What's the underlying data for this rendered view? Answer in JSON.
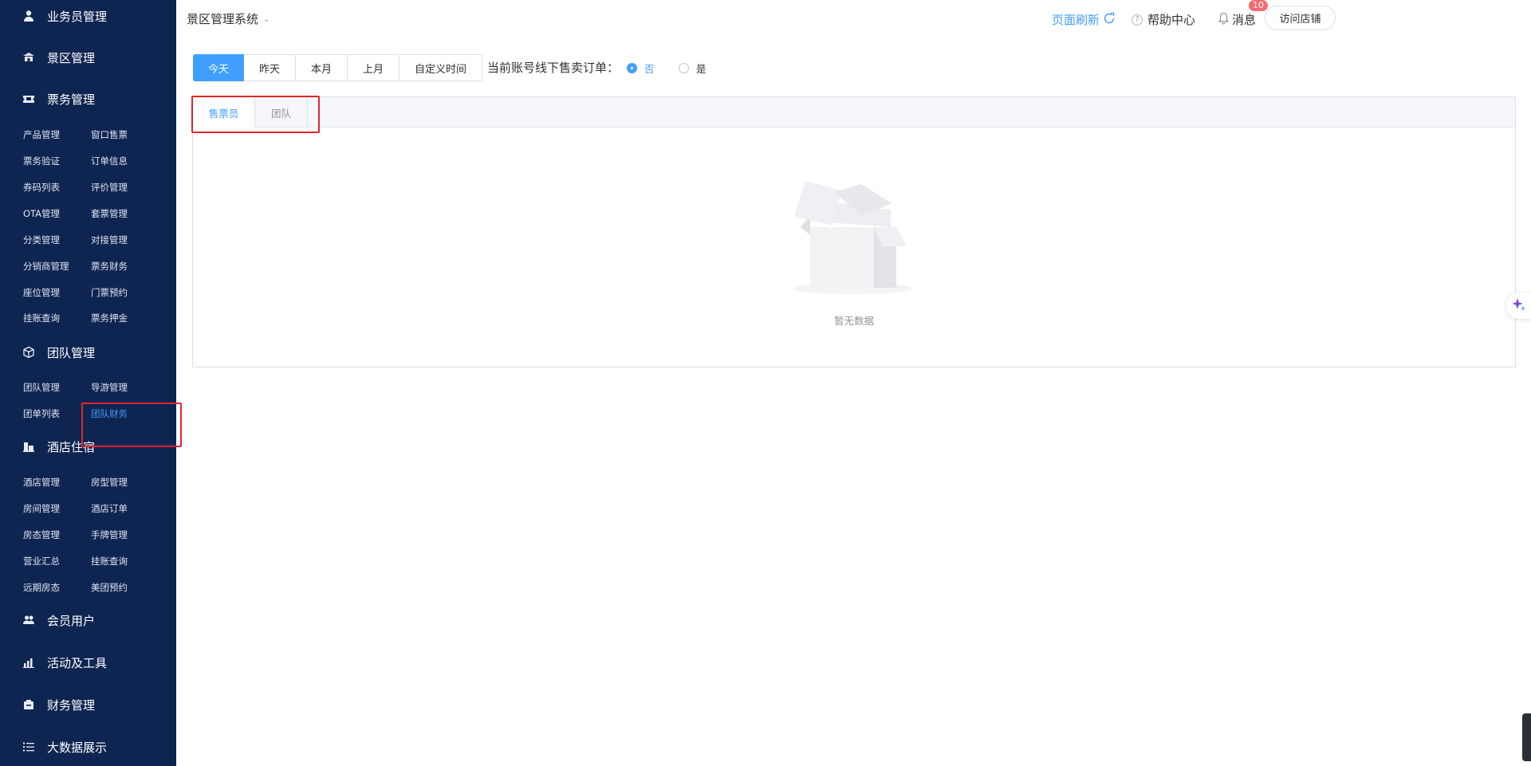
{
  "header": {
    "system_title": "景区管理系统",
    "refresh": "页面刷新",
    "help": "帮助中心",
    "messages": "消息",
    "message_count": "10",
    "visit_store": "访问店铺"
  },
  "sidebar": {
    "groups": [
      {
        "label": "业务员管理",
        "icon": "user-icon"
      },
      {
        "label": "景区管理",
        "icon": "scenic-icon"
      },
      {
        "label": "票务管理",
        "icon": "ticket-icon",
        "items": [
          "产品管理",
          "窗口售票",
          "票务验证",
          "订单信息",
          "券码列表",
          "评价管理",
          "OTA管理",
          "套票管理",
          "分类管理",
          "对接管理",
          "分销商管理",
          "票务财务",
          "座位管理",
          "门票预约",
          "挂账查询",
          "票务押金"
        ]
      },
      {
        "label": "团队管理",
        "icon": "cube-icon",
        "items": [
          "团队管理",
          "导游管理",
          "团单列表",
          "团队财务"
        ]
      },
      {
        "label": "酒店住宿",
        "icon": "hotel-icon",
        "items": [
          "酒店管理",
          "房型管理",
          "房间管理",
          "酒店订单",
          "房态管理",
          "手牌管理",
          "营业汇总",
          "挂账查询",
          "远期房态",
          "美团预约"
        ]
      },
      {
        "label": "会员用户",
        "icon": "members-icon"
      },
      {
        "label": "活动及工具",
        "icon": "chart-icon"
      },
      {
        "label": "财务管理",
        "icon": "finance-icon"
      },
      {
        "label": "大数据展示",
        "icon": "list-icon"
      }
    ],
    "active_item": "团队财务"
  },
  "filters": {
    "date_buttons": [
      "今天",
      "昨天",
      "本月",
      "上月",
      "自定义时间"
    ],
    "active_date": "今天",
    "offline_label": "当前账号线下售卖订单：",
    "radio_no": "否",
    "radio_yes": "是",
    "radio_selected": "否"
  },
  "tabs": [
    "售票员",
    "团队"
  ],
  "active_tab": "售票员",
  "empty_text": "暂无数据",
  "colors": {
    "sidebar_bg": "#0f2551",
    "accent": "#409eff",
    "annotation": "#e5242b"
  }
}
